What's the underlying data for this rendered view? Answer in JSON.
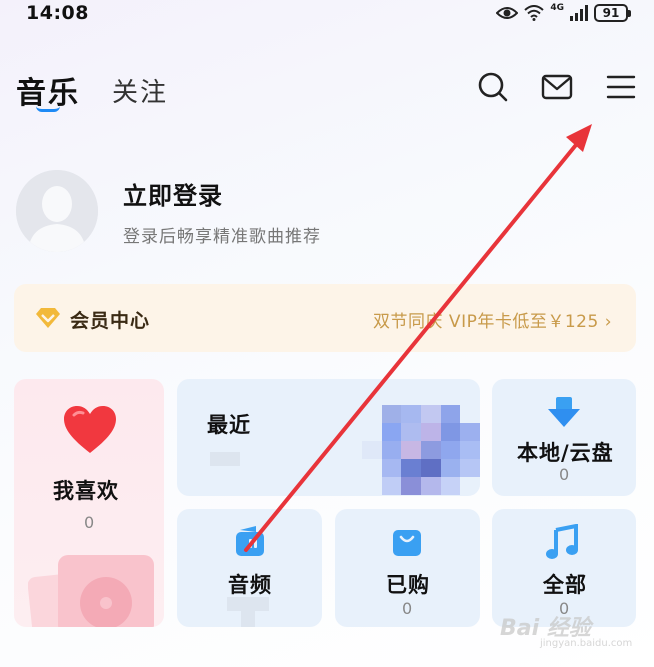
{
  "status_bar": {
    "time": "14:08",
    "network": "4G",
    "battery": "91"
  },
  "tabs": {
    "music": "音乐",
    "follow": "关注"
  },
  "header_icons": [
    "search-icon",
    "mail-icon",
    "menu-icon"
  ],
  "profile": {
    "title": "立即登录",
    "subtitle": "登录后畅享精准歌曲推荐"
  },
  "vip": {
    "title": "会员中心",
    "promo": "双节同庆 VIP年卡低至￥125",
    "chevron": "›"
  },
  "cards": {
    "favorite": {
      "label": "我喜欢",
      "count": "0"
    },
    "recent": {
      "label": "最近"
    },
    "local": {
      "label": "本地/云盘",
      "count": "0"
    },
    "audio": {
      "label": "音频"
    },
    "bought": {
      "label": "已购",
      "count": "0"
    },
    "all": {
      "label": "全部",
      "count": "0"
    }
  },
  "colors": {
    "accent": "#1e8af5",
    "vip_gold": "#c89a4a",
    "card_bg": "#e8f1fb",
    "favorite_bg": "#fde9ee",
    "annotation_arrow": "#e8343a"
  },
  "watermark": {
    "main": "Bai 经验",
    "sub": "jingyan.baidu.com"
  }
}
